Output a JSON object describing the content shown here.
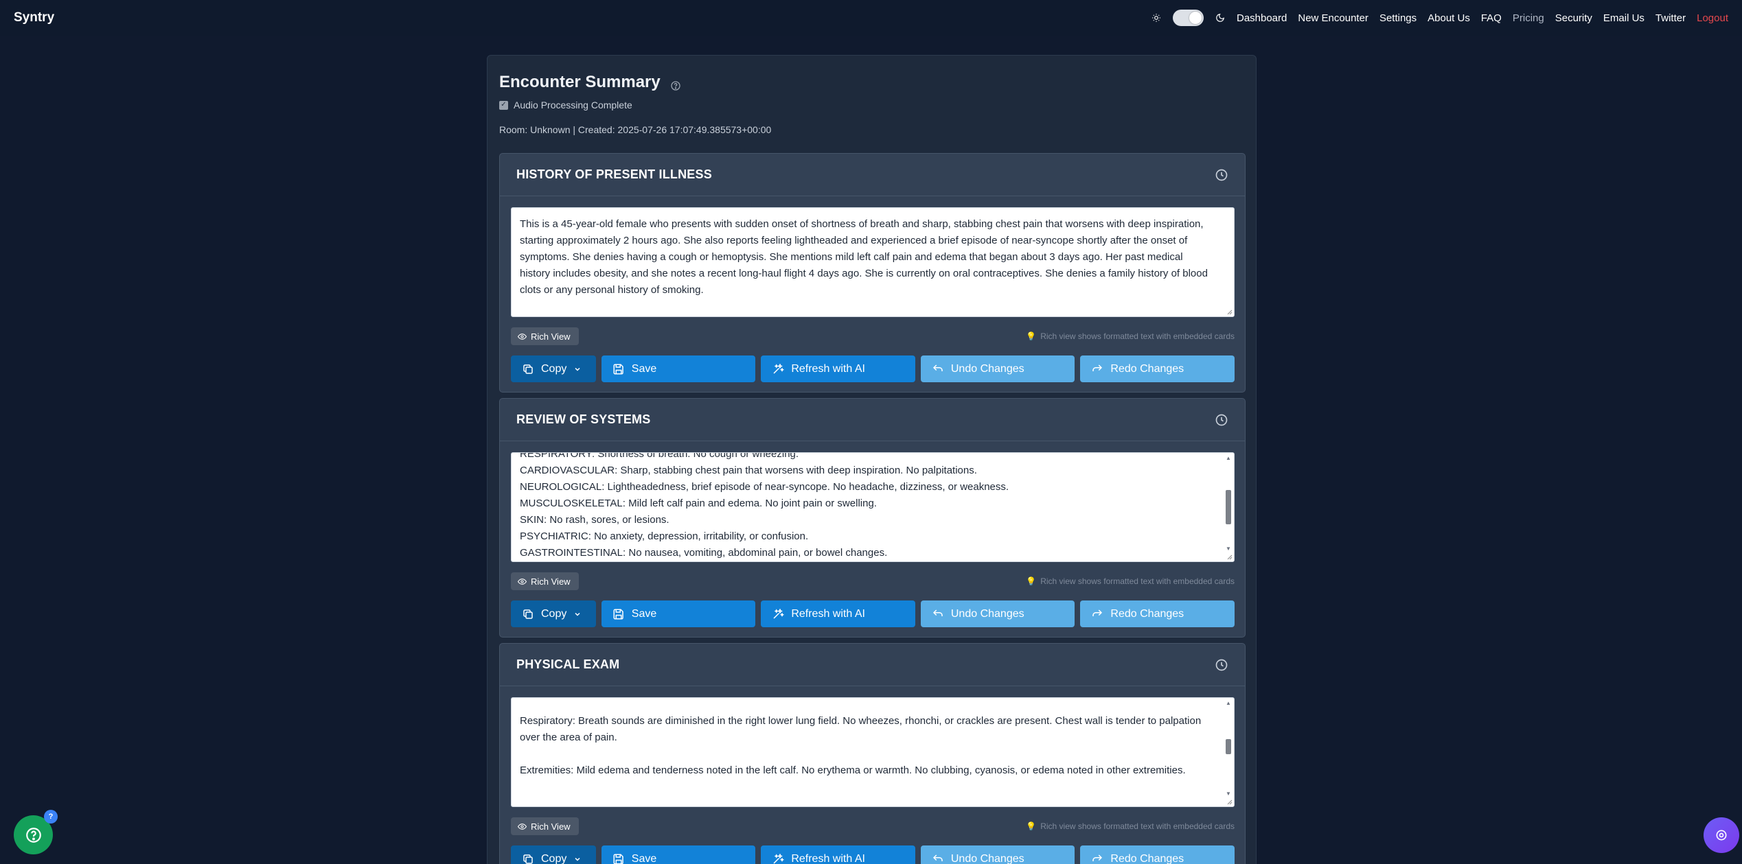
{
  "navbar": {
    "brand": "Syntry",
    "links": [
      "Dashboard",
      "New Encounter",
      "Settings",
      "About Us",
      "FAQ",
      "Pricing",
      "Security",
      "Email Us",
      "Twitter",
      "Logout"
    ]
  },
  "encounter": {
    "title": "Encounter Summary",
    "audio_status": "Audio Processing Complete",
    "meta": "Room: Unknown | Created: 2025-07-26 17:07:49.385573+00:00"
  },
  "common": {
    "rich_view": "Rich View",
    "hint": "Rich view shows formatted text with embedded cards",
    "copy": "Copy",
    "save": "Save",
    "refresh": "Refresh with AI",
    "undo": "Undo Changes",
    "redo": "Redo Changes"
  },
  "sections": [
    {
      "title": "HISTORY OF PRESENT ILLNESS",
      "text": "This is a 45-year-old female who presents with sudden onset of shortness of breath and sharp, stabbing chest pain that worsens with deep inspiration, starting approximately 2 hours ago. She also reports feeling lightheaded and experienced a brief episode of near-syncope shortly after the onset of symptoms. She denies having a cough or hemoptysis. She mentions mild left calf pain and edema that began about 3 days ago. Her past medical history includes obesity, and she notes a recent long-haul flight 4 days ago. She is currently on oral contraceptives. She denies a family history of blood clots or any personal history of smoking."
    },
    {
      "title": "REVIEW OF SYSTEMS",
      "text": "RESPIRATORY: Shortness of breath. No cough or wheezing.\nCARDIOVASCULAR: Sharp, stabbing chest pain that worsens with deep inspiration. No palpitations.\nNEUROLOGICAL: Lightheadedness, brief episode of near-syncope. No headache, dizziness, or weakness.\nMUSCULOSKELETAL: Mild left calf pain and edema. No joint pain or swelling.\nSKIN: No rash, sores, or lesions.\nPSYCHIATRIC: No anxiety, depression, irritability, or confusion.\nGASTROINTESTINAL: No nausea, vomiting, abdominal pain, or bowel changes."
    },
    {
      "title": "PHYSICAL EXAM",
      "text": "\nRespiratory: Breath sounds are diminished in the right lower lung field. No wheezes, rhonchi, or crackles are present. Chest wall is tender to palpation over the area of pain.\n\nExtremities: Mild edema and tenderness noted in the left calf. No erythema or warmth. No clubbing, cyanosis, or edema noted in other extremities."
    }
  ],
  "help_badge": "?",
  "icons": {
    "theme_light": "sun-icon",
    "theme_dark": "moon-icon",
    "help": "question-circle-icon",
    "history": "clock-icon",
    "rich_view": "eye-icon",
    "hint": "lightbulb-icon",
    "copy": "copy-icon",
    "save": "save-icon",
    "refresh": "sparkle-icon",
    "undo": "undo-icon",
    "redo": "redo-icon",
    "assistant": "assistant-icon"
  },
  "colors": {
    "background": "#101a2e",
    "card": "#1e2a3c",
    "section": "#334155",
    "primary": "#1282d8",
    "primary_dark": "#0b5fa0",
    "secondary": "#5aaee6",
    "logout": "#e5484d",
    "help_fab": "#14a05a",
    "assistant_fab": "#7c3aed"
  }
}
